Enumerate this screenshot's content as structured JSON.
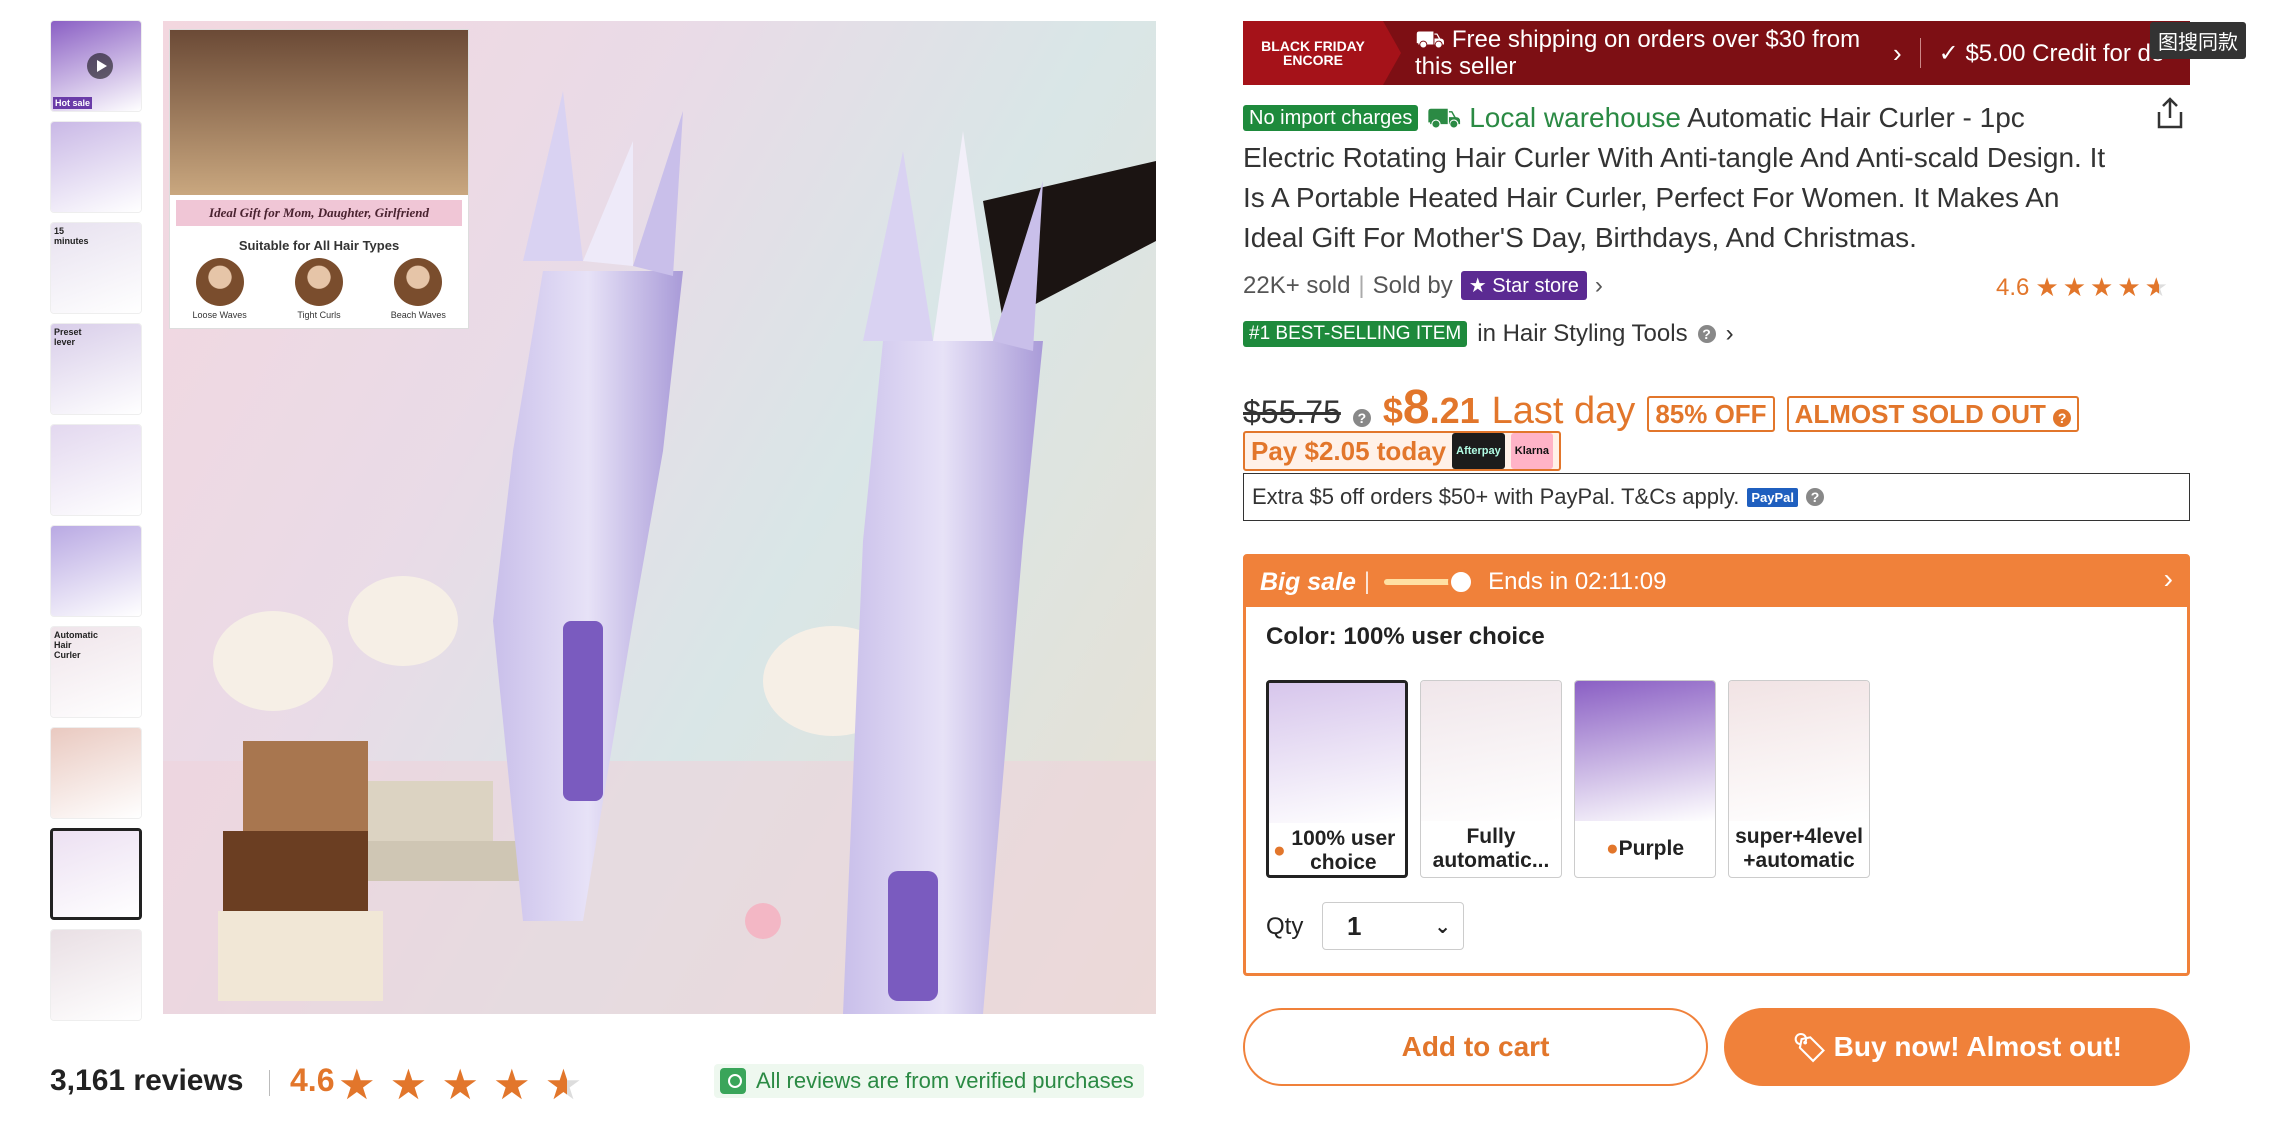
{
  "thumbnails": [
    {
      "type": "video",
      "tag": "Hot sale",
      "bg": "#8a5fc4"
    },
    {
      "type": "image",
      "bg": "#c9b8e6"
    },
    {
      "type": "image",
      "caption": "15 minutes",
      "bg": "#e7e1ef"
    },
    {
      "type": "image",
      "caption": "Preset lever",
      "bg": "#d8cde9"
    },
    {
      "type": "image",
      "bg": "#e3d8ef"
    },
    {
      "type": "image",
      "bg": "#b9a9e3"
    },
    {
      "type": "image",
      "caption": "Automatic Hair Curler",
      "bg": "#efe4ea"
    },
    {
      "type": "image",
      "bg": "#e9c9c0"
    },
    {
      "type": "image",
      "selected": true,
      "bg": "#ece0f2"
    },
    {
      "type": "image",
      "bg": "#e9dfe4"
    }
  ],
  "main_image": {
    "inset": {
      "gift_text": "Ideal Gift for Mom, Daughter, Girlfriend",
      "suitable_text": "Suitable for All Hair Types",
      "types": [
        "Loose Waves",
        "Tight Curls",
        "Beach Waves"
      ]
    }
  },
  "reviews": {
    "count_label": "3,161 reviews",
    "score": "4.6",
    "verified_text": "All reviews are from verified purchases"
  },
  "promo": {
    "badge_line1": "BLACK FRIDAY",
    "badge_line2": "ENCORE",
    "shipping_text": "Free shipping on orders over $30 from this seller",
    "credit_text": "$5.00 Credit for de",
    "overlay_badge": "图搜同款"
  },
  "product": {
    "no_import_tag": "No import charges",
    "local_warehouse": "Local warehouse",
    "title": "Automatic Hair Curler - 1pc Electric Rotating Hair Curler With Anti-tangle And Anti-scald Design. It Is A Portable Heated Hair Curler, Perfect For Women. It Makes An Ideal Gift For Mother'S Day, Birthdays, And Christmas.",
    "sold": "22K+ sold",
    "sold_by": "Sold by",
    "store_name": "Star store",
    "rating": "4.6",
    "best_tag": "#1 BEST-SELLING ITEM",
    "best_category": "in Hair Styling Tools"
  },
  "price": {
    "old": "$55.75",
    "currency": "$",
    "int": "8",
    "dec": ".21",
    "last_day": "Last day",
    "off": "85% OFF",
    "almost_sold": "ALMOST SOLD OUT",
    "pay_today": "Pay $2.05 today",
    "afterpay": "Afterpay",
    "klarna": "Klarna"
  },
  "paypal": {
    "text": "Extra $5 off orders $50+ with PayPal. T&Cs apply.",
    "logo": "PayPal"
  },
  "sale": {
    "label": "Big sale",
    "ends": "Ends in 02:11:09",
    "color_label": "Color: 100% user choice",
    "swatches": [
      {
        "label": "100% user choice",
        "flame": true,
        "selected": true,
        "bg": "#d7c6ec"
      },
      {
        "label": "Fully automatic...",
        "flame": false,
        "selected": false,
        "bg": "#f0e6ea"
      },
      {
        "label": "Purple",
        "flame": true,
        "selected": false,
        "bg": "#8a5fc4"
      },
      {
        "label": "super+4level +automatic",
        "flame": false,
        "selected": false,
        "bg": "#f1e3e4"
      }
    ],
    "qty_label": "Qty",
    "qty_value": "1"
  },
  "buttons": {
    "add_to_cart": "Add to cart",
    "buy_now": "Buy now! Almost out!"
  },
  "colors": {
    "accent": "#f0813a",
    "price": "#e2762b",
    "green": "#1e8a3c",
    "promo_bg": "#7d0f14",
    "store": "#5b2a92"
  }
}
